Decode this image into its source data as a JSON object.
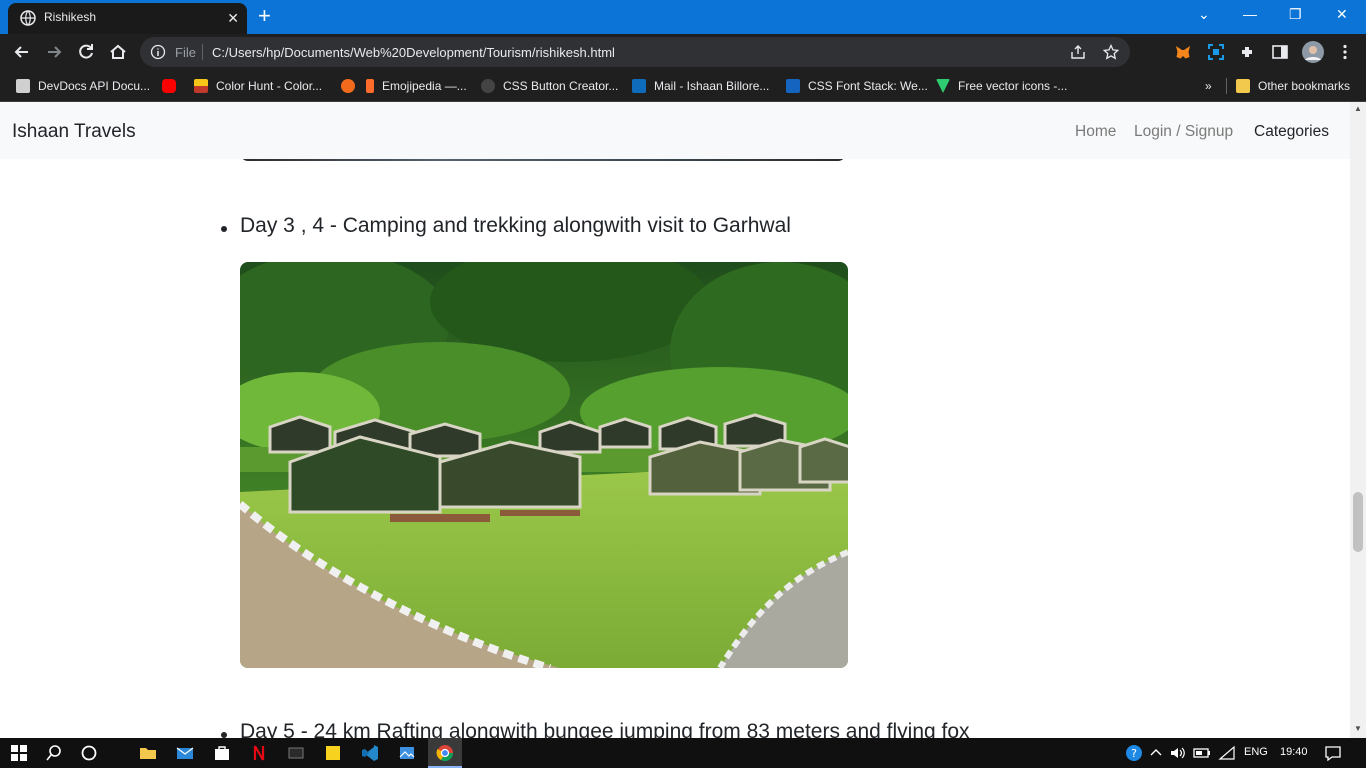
{
  "browser": {
    "tab_title": "Rishikesh",
    "tab_close": "✕",
    "new_tab": "+",
    "window_controls": {
      "minimize": "—",
      "restore": "❐",
      "close": "✕",
      "tabsearch": "⌄"
    },
    "address": {
      "scheme_label": "File",
      "url": "C:/Users/hp/Documents/Web%20Development/Tourism/rishikesh.html"
    }
  },
  "bookmarks": {
    "items": [
      {
        "label": "DevDocs API Docu...",
        "icon": "devdocs-icon",
        "color": "#d0d0d0"
      },
      {
        "label": "",
        "icon": "youtube-icon",
        "color": "#ff0000"
      },
      {
        "label": "Color Hunt - Color...",
        "icon": "colorhunt-icon",
        "color": "#f5c518"
      },
      {
        "label": "",
        "icon": "feedly-icon",
        "color": "#f26b1d"
      },
      {
        "label": "Emojipedia —...",
        "icon": "emojipedia-icon",
        "color": "#ff6b2b"
      },
      {
        "label": "CSS Button Creator...",
        "icon": "css-button-icon",
        "color": "#444444"
      },
      {
        "label": "Mail - Ishaan Billore...",
        "icon": "outlook-icon",
        "color": "#0f6cbd"
      },
      {
        "label": "CSS Font Stack: We...",
        "icon": "fontstack-icon",
        "color": "#1565c0"
      },
      {
        "label": "Free vector icons -...",
        "icon": "vector-icons-icon",
        "color": "#2ecc71"
      }
    ],
    "overflow": "»",
    "other_bookmarks": "Other bookmarks"
  },
  "site": {
    "brand": "Ishaan Travels",
    "nav": [
      {
        "label": "Home",
        "active": false
      },
      {
        "label": "Login / Signup",
        "active": false
      },
      {
        "label": "Categories",
        "active": true
      }
    ]
  },
  "content": {
    "items": [
      {
        "text": "Day 3 , 4 - Camping and trekking alongwith visit to Garhwal"
      },
      {
        "text": "Day 5 - 24 km Rafting alongwith bungee jumping from 83 meters and flying fox"
      }
    ]
  },
  "taskbar": {
    "language": "ENG",
    "time": "19:40"
  }
}
